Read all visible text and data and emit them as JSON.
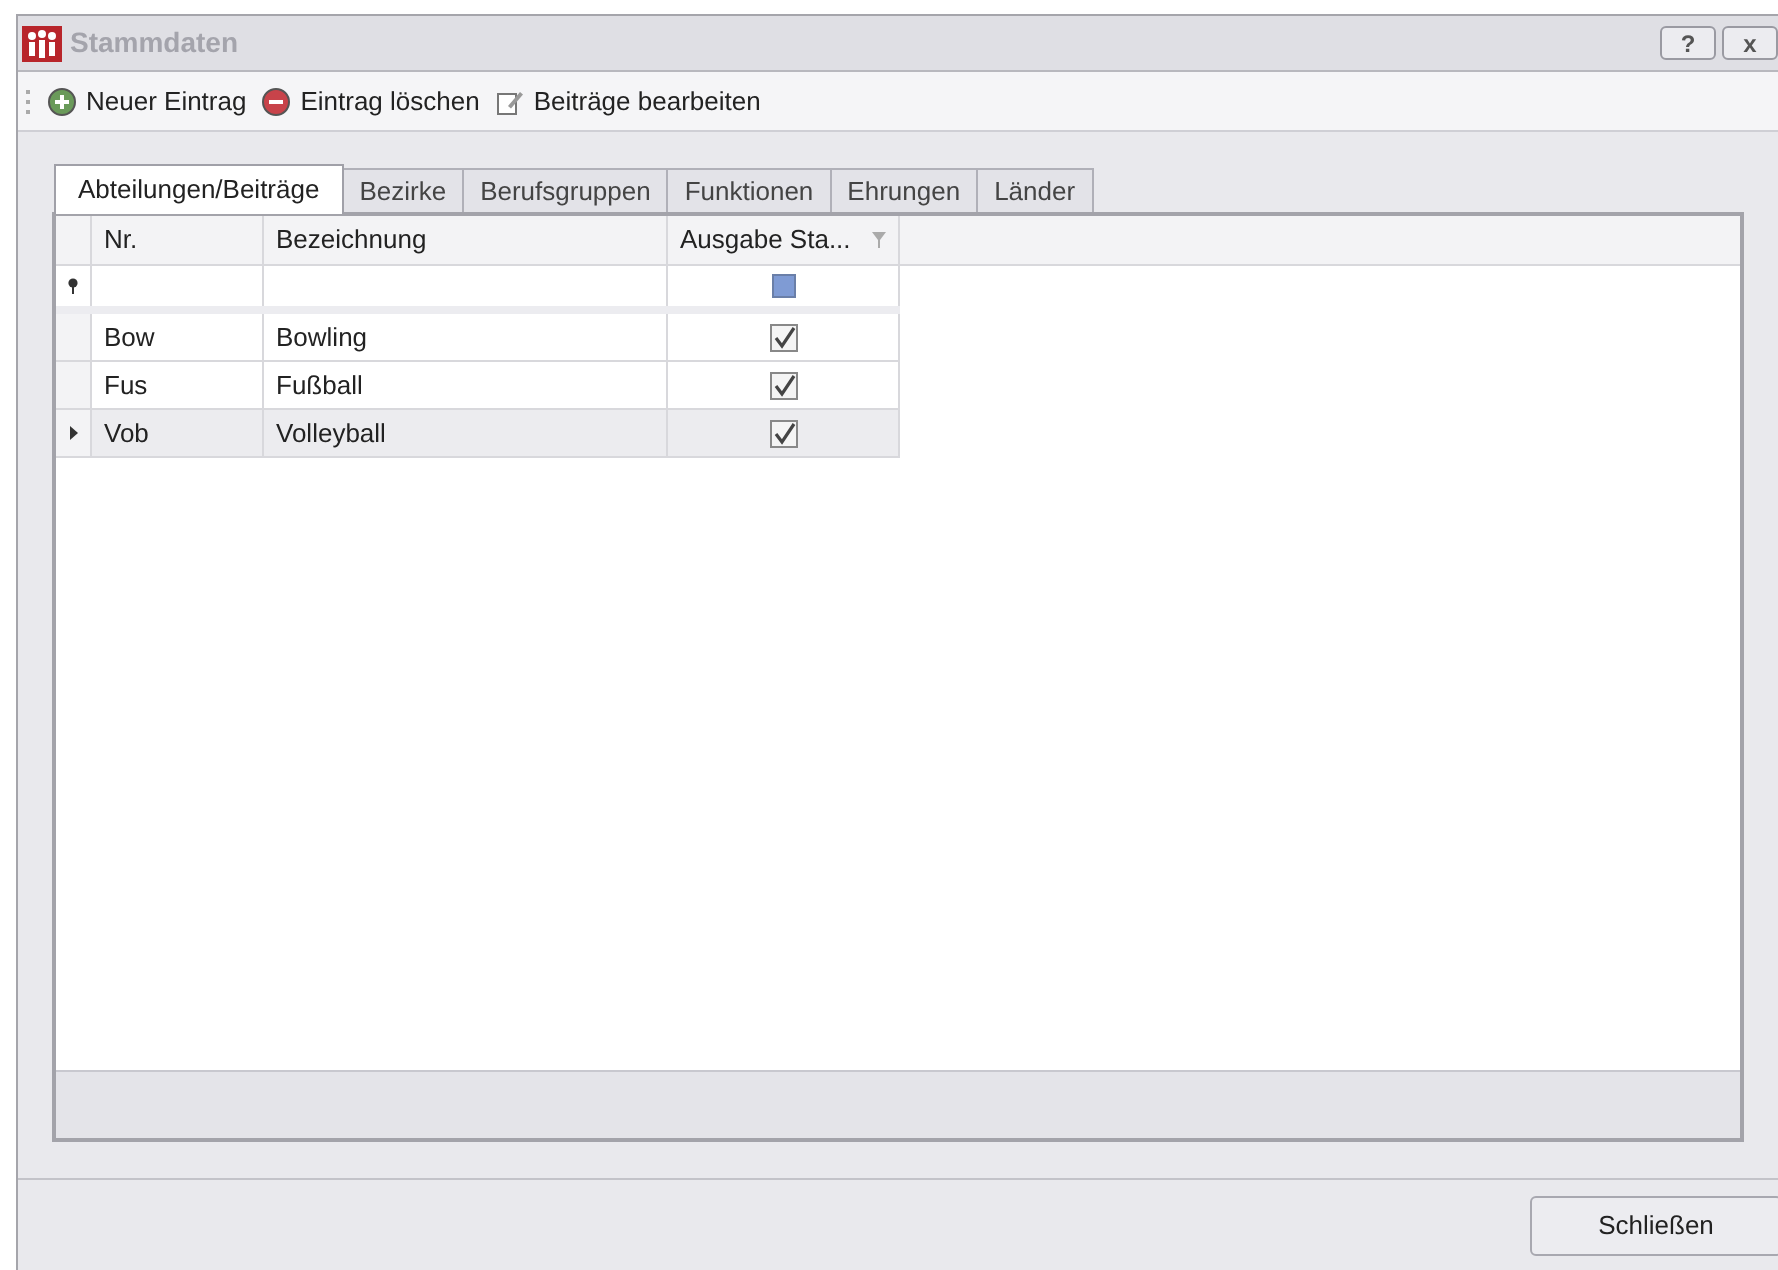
{
  "window": {
    "title": "Stammdaten",
    "buttons": [
      "?",
      "x"
    ]
  },
  "toolbar": [
    {
      "kind": "add",
      "label": "Neuer Eintrag"
    },
    {
      "kind": "delete",
      "label": "Eintrag löschen"
    },
    {
      "kind": "edit",
      "label": "Beiträge bearbeiten"
    }
  ],
  "tabs": [
    {
      "label": "Abteilungen/Beiträge",
      "selected": true
    },
    {
      "label": "Bezirke",
      "selected": false
    },
    {
      "label": "Berufsgruppen",
      "selected": false
    },
    {
      "label": "Funktionen",
      "selected": false
    },
    {
      "label": "Ehrungen",
      "selected": false
    },
    {
      "label": "Länder",
      "selected": false
    }
  ],
  "table": {
    "columns": [
      "Nr.",
      "Bezeichnung",
      "Ausgabe Sta..."
    ],
    "filter_indeterminate": true,
    "rows": [
      {
        "nr": "Bow",
        "name": "Bowling",
        "checked": true,
        "selected": false
      },
      {
        "nr": "Fus",
        "name": "Fußball",
        "checked": true,
        "selected": false
      },
      {
        "nr": "Vob",
        "name": "Volleyball",
        "checked": true,
        "selected": true
      }
    ]
  },
  "footer": {
    "button": "Schließen"
  }
}
